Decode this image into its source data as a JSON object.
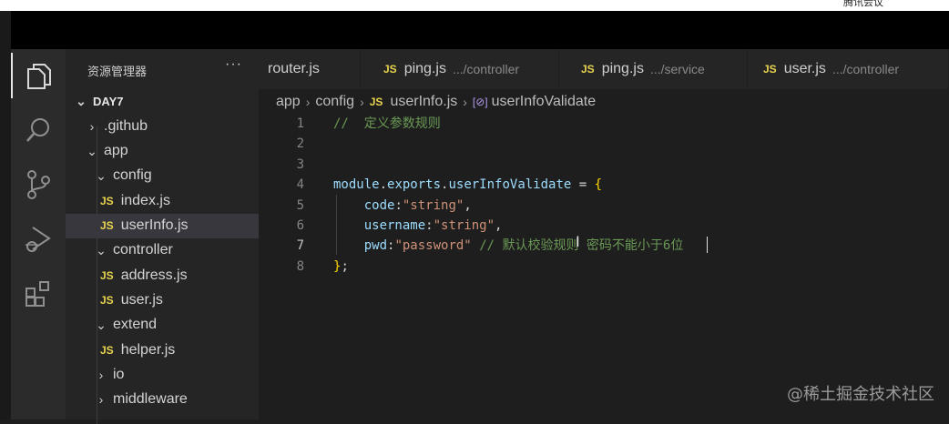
{
  "meeting_label": "腾讯会议",
  "sidebar": {
    "title": "资源管理器",
    "more": "···",
    "tree": [
      {
        "label": "DAY7",
        "chev": "⌄",
        "depth": 0,
        "root": true
      },
      {
        "label": ".github",
        "chev": "›",
        "depth": 1
      },
      {
        "label": "app",
        "chev": "⌄",
        "depth": 1
      },
      {
        "label": "config",
        "chev": "⌄",
        "depth": 2
      },
      {
        "label": "index.js",
        "js": true,
        "depth": 3
      },
      {
        "label": "userInfo.js",
        "js": true,
        "depth": 3,
        "selected": true
      },
      {
        "label": "controller",
        "chev": "⌄",
        "depth": 2
      },
      {
        "label": "address.js",
        "js": true,
        "depth": 3
      },
      {
        "label": "user.js",
        "js": true,
        "depth": 3
      },
      {
        "label": "extend",
        "chev": "⌄",
        "depth": 2
      },
      {
        "label": "helper.js",
        "js": true,
        "depth": 3
      },
      {
        "label": "io",
        "chev": "›",
        "depth": 2
      },
      {
        "label": "middleware",
        "chev": "›",
        "depth": 2
      }
    ],
    "js_badge": "JS"
  },
  "tabs": [
    {
      "label": "router.js",
      "desc": "",
      "js": false
    },
    {
      "label": "ping.js",
      "desc": ".../controller",
      "js": true
    },
    {
      "label": "ping.js",
      "desc": ".../service",
      "js": true
    },
    {
      "label": "user.js",
      "desc": ".../controller",
      "js": true
    }
  ],
  "breadcrumb": {
    "items": [
      "app",
      "config",
      "userInfo.js",
      "userInfoValidate"
    ],
    "sep": "›",
    "js_badge": "JS",
    "symbol_icon": "[⊘]"
  },
  "editor": {
    "line_numbers": [
      "1",
      "2",
      "3",
      "4",
      "5",
      "6",
      "7",
      "8"
    ],
    "current_line": 7,
    "lines": [
      [
        {
          "t": "//  定义参数规则",
          "c": "comment"
        }
      ],
      [],
      [],
      [
        {
          "t": "module",
          "c": "prop"
        },
        {
          "t": ".",
          "c": "op"
        },
        {
          "t": "exports",
          "c": "prop"
        },
        {
          "t": ".",
          "c": "op"
        },
        {
          "t": "userInfoValidate",
          "c": "prop"
        },
        {
          "t": " = ",
          "c": "op"
        },
        {
          "t": "{",
          "c": "brace"
        }
      ],
      [
        {
          "t": "    ",
          "c": "op"
        },
        {
          "t": "code",
          "c": "prop"
        },
        {
          "t": ":",
          "c": "op"
        },
        {
          "t": "\"string\"",
          "c": "str"
        },
        {
          "t": ",",
          "c": "op"
        }
      ],
      [
        {
          "t": "    ",
          "c": "op"
        },
        {
          "t": "username",
          "c": "prop"
        },
        {
          "t": ":",
          "c": "op"
        },
        {
          "t": "\"string\"",
          "c": "str"
        },
        {
          "t": ",",
          "c": "op"
        }
      ],
      [
        {
          "t": "    ",
          "c": "op"
        },
        {
          "t": "pwd",
          "c": "prop"
        },
        {
          "t": ":",
          "c": "op"
        },
        {
          "t": "\"password\"",
          "c": "str"
        },
        {
          "t": " ",
          "c": "op"
        },
        {
          "t": "// 默认校验规则 密码不能小于6位",
          "c": "comment"
        }
      ],
      [
        {
          "t": "}",
          "c": "brace"
        },
        {
          "t": ";",
          "c": "op"
        }
      ]
    ]
  },
  "watermark": "@稀土掘金技术社区",
  "icons": [
    "files-icon",
    "search-icon",
    "source-control-icon",
    "run-debug-icon",
    "extensions-icon"
  ]
}
